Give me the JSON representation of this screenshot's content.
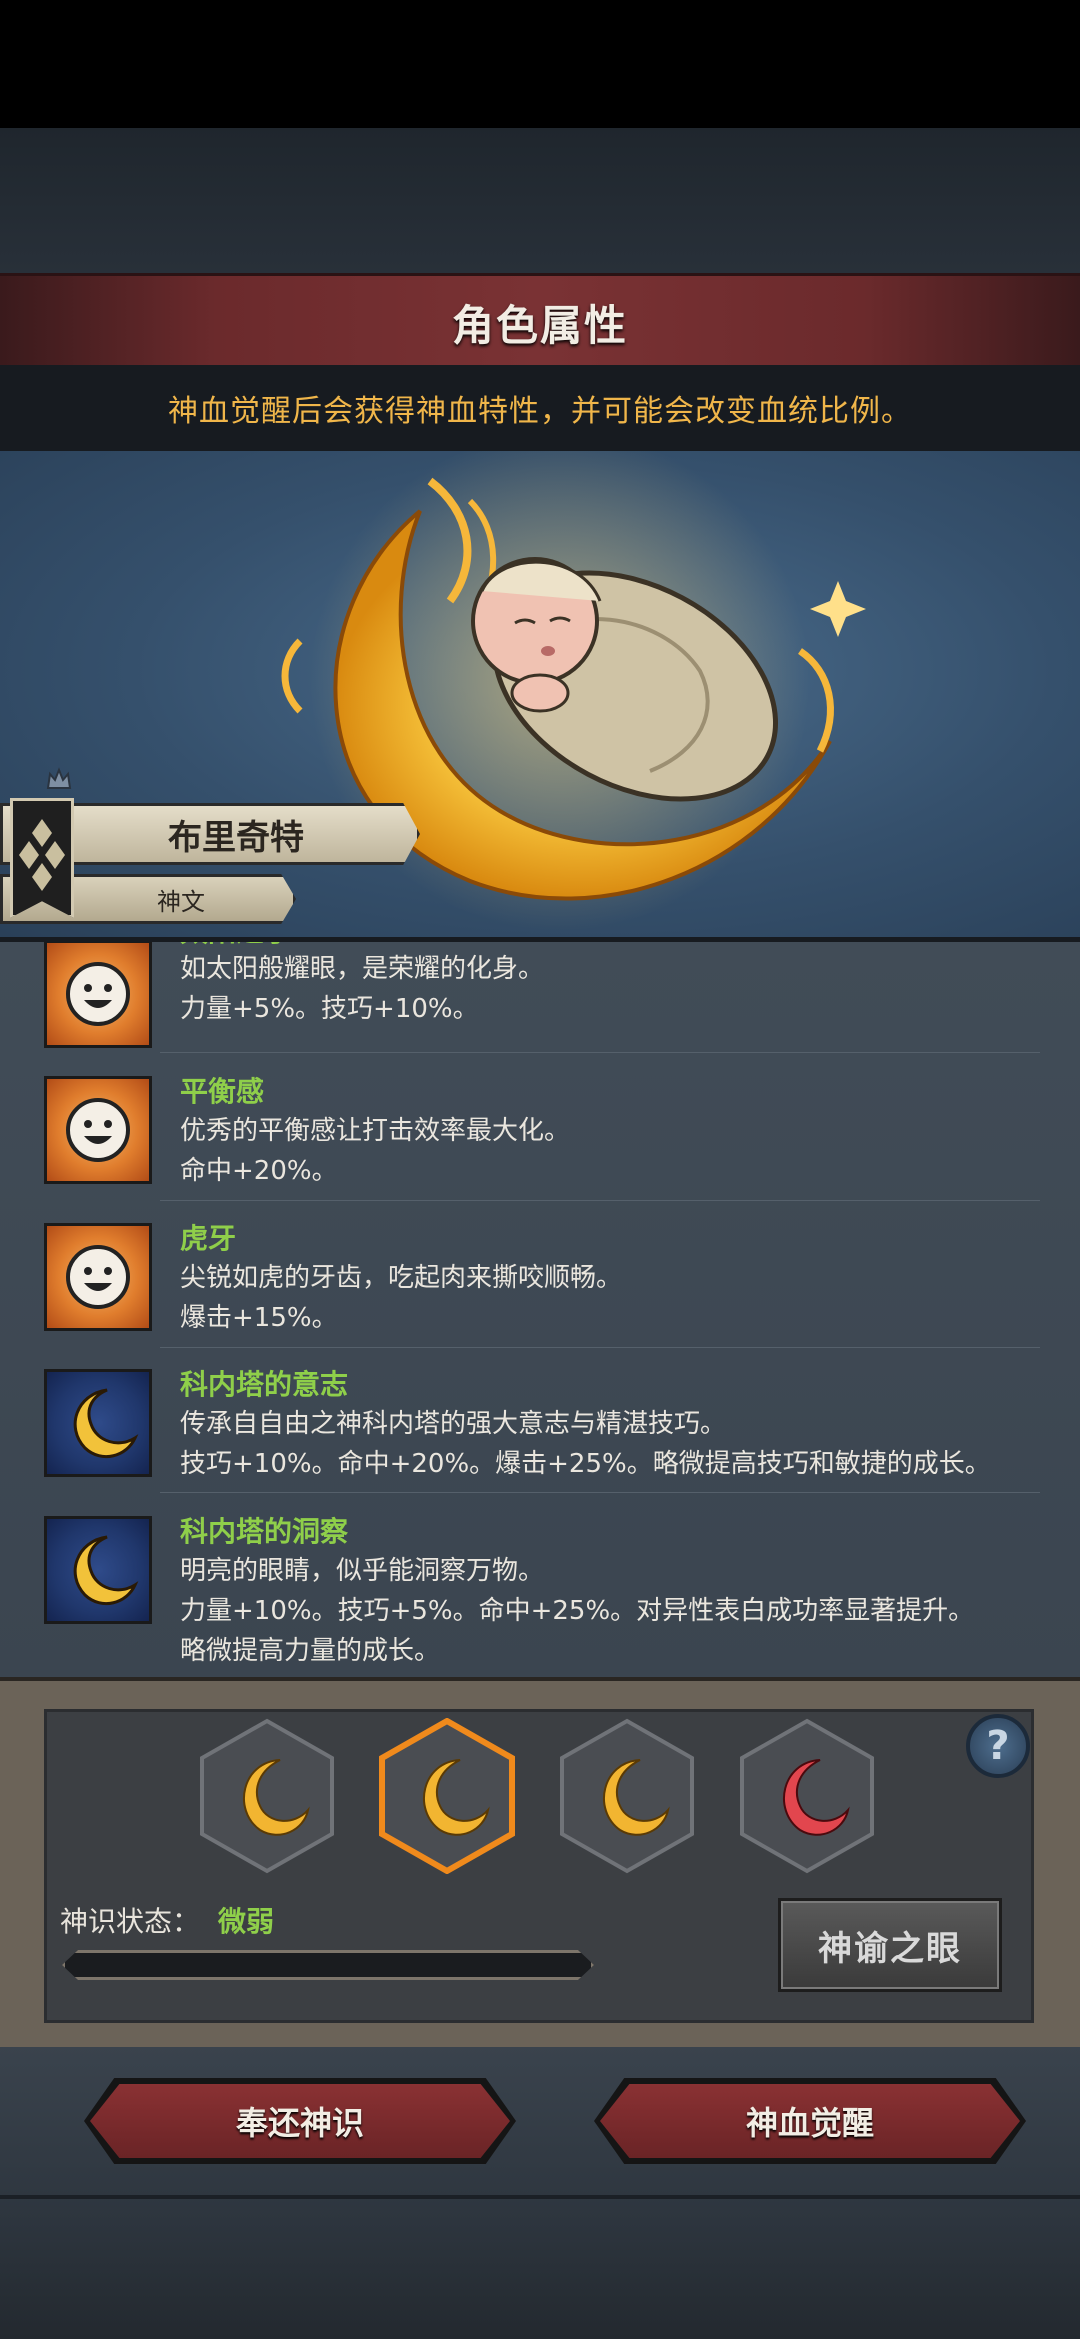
{
  "header": {
    "title": "角色属性"
  },
  "notice": {
    "text": "神血觉醒后会获得神血特性，并可能会改变血统比例。"
  },
  "character": {
    "name": "布里奇特",
    "category": "神文"
  },
  "traits": [
    {
      "name": "太阳之子",
      "desc": "如太阳般耀眼，是荣耀的化身。",
      "stat": "力量+5%。技巧+10%。",
      "icon": "smiley-sun-icon"
    },
    {
      "name": "平衡感",
      "desc": "优秀的平衡感让打击效率最大化。",
      "stat": "命中+20%。",
      "icon": "smiley-sun-icon"
    },
    {
      "name": "虎牙",
      "desc": "尖锐如虎的牙齿，吃起肉来撕咬顺畅。",
      "stat": "爆击+15%。",
      "icon": "smiley-sun-icon"
    },
    {
      "name": "科内塔的意志",
      "desc": "传承自自由之神科内塔的强大意志与精湛技巧。",
      "stat": "技巧+10%。命中+20%。爆击+25%。略微提高技巧和敏捷的成长。",
      "icon": "crescent-moon-icon"
    },
    {
      "name": "科内塔的洞察",
      "desc": "明亮的眼睛，似乎能洞察万物。",
      "stat": "力量+10%。技巧+5%。命中+25%。对异性表白成功率显著提升。",
      "stat2": "略微提高力量的成长。",
      "icon": "crescent-moon-icon"
    }
  ],
  "awakening": {
    "slots": [
      {
        "icon": "gold-crescent-icon",
        "color": "#f2b531",
        "selected": false
      },
      {
        "icon": "gold-crescent-icon",
        "color": "#f2b531",
        "selected": true
      },
      {
        "icon": "gold-crescent-icon",
        "color": "#f2b531",
        "selected": false
      },
      {
        "icon": "red-crescent-icon",
        "color": "#e2464e",
        "selected": false
      }
    ],
    "state_label": "神识状态：",
    "state_value": "微弱",
    "progress": 0.0,
    "oracle_button": "神谕之眼",
    "help_icon": "question-mark-icon"
  },
  "buttons": {
    "return": "奉还神识",
    "awaken": "神血觉醒"
  }
}
